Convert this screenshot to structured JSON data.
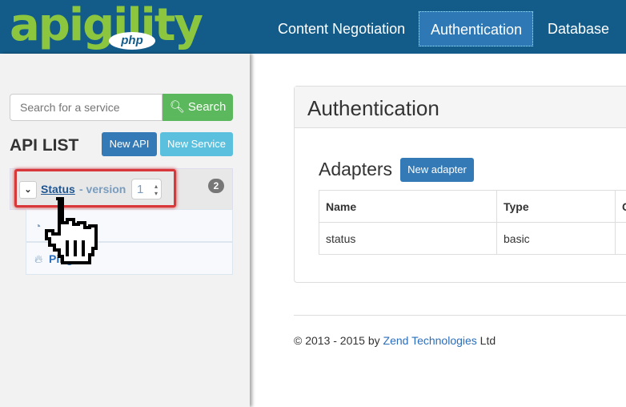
{
  "header": {
    "logo": "apigility",
    "logo_sub": "php",
    "nav": [
      "Content Negotiation",
      "Authentication",
      "Database"
    ]
  },
  "sidebar": {
    "search_placeholder": "Search for a service",
    "search_button": "Search",
    "api_list_title": "API LIST",
    "new_api": "New API",
    "new_service": "New Service",
    "api": {
      "name": "Status",
      "version_label": "- version",
      "version": "1",
      "count": "2",
      "services": [
        "",
        "Ping"
      ]
    }
  },
  "main": {
    "title": "Authentication",
    "adapters_title": "Adapters",
    "new_adapter": "New adapter",
    "columns": [
      "Name",
      "Type",
      "C"
    ],
    "rows": [
      [
        "status",
        "basic",
        ""
      ]
    ]
  },
  "footer": {
    "prefix": "© 2013 - 2015 by ",
    "company": "Zend Technologies",
    "suffix": " Ltd"
  },
  "colors": {
    "nav": "#135c8a",
    "accent": "#2e79b5",
    "success": "#5cb85c",
    "info": "#5bc0de",
    "highlight": "#d9383b"
  }
}
